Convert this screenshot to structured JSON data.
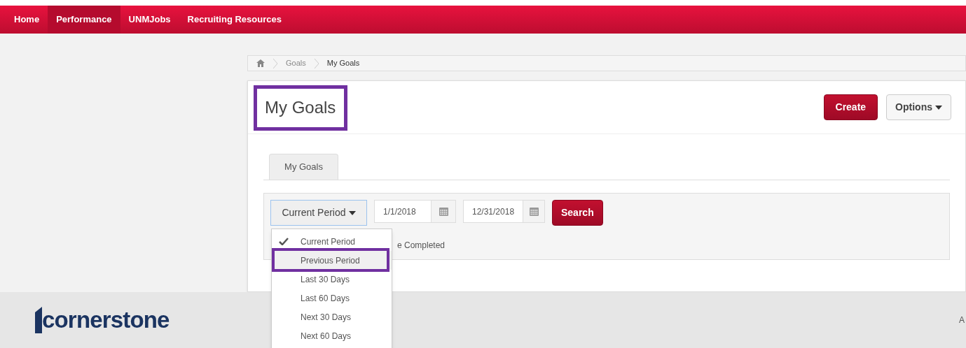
{
  "nav": {
    "items": [
      {
        "label": "Home",
        "selected": false
      },
      {
        "label": "Performance",
        "selected": true
      },
      {
        "label": "UNMJobs",
        "selected": false
      },
      {
        "label": "Recruiting Resources",
        "selected": false
      }
    ]
  },
  "breadcrumb": [
    "Goals",
    "My Goals"
  ],
  "page": {
    "title": "My Goals",
    "buttons": [
      {
        "label": "Create",
        "kind": "primary"
      },
      {
        "label": "Options",
        "kind": "dropdown"
      }
    ]
  },
  "tabs": [
    {
      "label": "My Goals",
      "selected": true
    }
  ],
  "filter": {
    "period": "Current Period",
    "start_date": "1/1/2018",
    "end_date": "12/31/2018",
    "search": "Search",
    "include_completed": "e Completed"
  },
  "period_menu": [
    {
      "label": "Current Period",
      "checked": true,
      "highlighted": false
    },
    {
      "label": "Previous Period",
      "checked": false,
      "highlighted": true
    },
    {
      "label": "Last 30 Days",
      "checked": false,
      "highlighted": false
    },
    {
      "label": "Last 60 Days",
      "checked": false,
      "highlighted": false
    },
    {
      "label": "Next 30 Days",
      "checked": false,
      "highlighted": false
    },
    {
      "label": "Next 60 Days",
      "checked": false,
      "highlighted": false
    }
  ],
  "footer": {
    "logo": "cornerstone",
    "right_text": "A"
  }
}
